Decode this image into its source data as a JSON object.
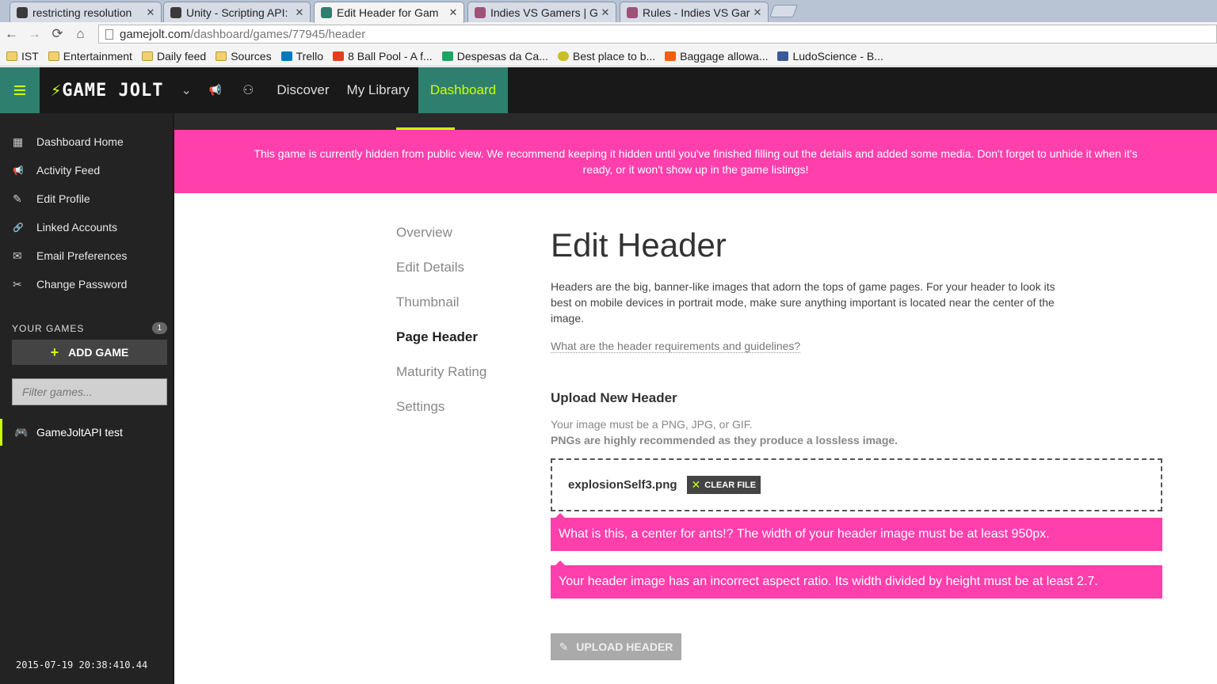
{
  "browser": {
    "tabs": [
      {
        "title": "restricting resolution",
        "favicon_color": "#3a3a3a"
      },
      {
        "title": "Unity - Scripting API:",
        "favicon_color": "#3a3a3a"
      },
      {
        "title": "Edit Header for Gam",
        "favicon_color": "#2f7f6f"
      },
      {
        "title": "Indies VS Gamers | G",
        "favicon_color": "#a05078"
      },
      {
        "title": "Rules - Indies VS Gar",
        "favicon_color": "#a05078"
      }
    ],
    "tab_close": "✕",
    "url_host": "gamejolt.com",
    "url_path": "/dashboard/games/77945/header",
    "nav": {
      "back": "←",
      "forward": "→",
      "reload": "⟳",
      "home": "⌂"
    },
    "bookmarks": [
      {
        "label": "IST",
        "type": "folder"
      },
      {
        "label": "Entertainment",
        "type": "folder"
      },
      {
        "label": "Daily feed",
        "type": "folder"
      },
      {
        "label": "Sources",
        "type": "folder"
      },
      {
        "label": "Trello",
        "color": "#0079bf"
      },
      {
        "label": "8 Ball Pool - A f...",
        "color": "#e0401c"
      },
      {
        "label": "Despesas da Ca...",
        "color": "#1da462"
      },
      {
        "label": "Best place to b...",
        "color": "#c8c020"
      },
      {
        "label": "Baggage allowa...",
        "color": "#f06010"
      },
      {
        "label": "LudoScience - B...",
        "color": "#3b5998"
      }
    ]
  },
  "topnav": {
    "logo": "GAME JOLT",
    "logo_bolt": "⚡",
    "dropdown_icon": "⌄",
    "icon1": "📢",
    "icon2": "⚇",
    "links": [
      {
        "label": "Discover"
      },
      {
        "label": "My Library"
      },
      {
        "label": "Dashboard"
      }
    ]
  },
  "sidebar": {
    "items": [
      {
        "label": "Dashboard Home",
        "icon": "▦"
      },
      {
        "label": "Activity Feed",
        "icon": "📢"
      },
      {
        "label": "Edit Profile",
        "icon": "✎"
      },
      {
        "label": "Linked Accounts",
        "icon": "🔗"
      },
      {
        "label": "Email Preferences",
        "icon": "✉"
      },
      {
        "label": "Change Password",
        "icon": "✂"
      }
    ],
    "your_games_label": "YOUR GAMES",
    "your_games_count": "1",
    "add_game_label": "ADD GAME",
    "add_game_icon": "+",
    "filter_placeholder": "Filter games...",
    "game": {
      "label": "GameJoltAPI test",
      "icon": "🎮"
    },
    "timestamp": "2015-07-19 20:38:410.44"
  },
  "banner": {
    "text": "This game is currently hidden from public view. We recommend keeping it hidden until you've finished filling out the details and added some media. Don't forget to unhide it when it's ready, or it won't show up in the game listings!"
  },
  "subnav": [
    {
      "label": "Overview"
    },
    {
      "label": "Edit Details"
    },
    {
      "label": "Thumbnail"
    },
    {
      "label": "Page Header"
    },
    {
      "label": "Maturity Rating"
    },
    {
      "label": "Settings"
    }
  ],
  "main": {
    "title": "Edit Header",
    "description": "Headers are the big, banner-like images that adorn the tops of game pages. For your header to look its best on mobile devices in portrait mode, make sure anything important is located near the center of the image.",
    "requirements_link": "What are the header requirements and guidelines?",
    "upload_heading": "Upload New Header",
    "format_line1": "Your image must be a PNG, JPG, or GIF.",
    "format_line2": "PNGs are highly recommended as they produce a lossless image.",
    "file_name": "explosionSelf3.png",
    "clear_file_label": "CLEAR FILE",
    "clear_icon": "✕",
    "errors": [
      "What is this, a center for ants!? The width of your header image must be at least 950px.",
      "Your header image has an incorrect aspect ratio. Its width divided by height must be at least 2.7."
    ],
    "upload_button_label": "UPLOAD HEADER",
    "upload_icon": "✎"
  },
  "colors": {
    "accent_lime": "#ccff00",
    "accent_teal": "#2f7f6f",
    "alert_pink": "#ff3fac"
  }
}
